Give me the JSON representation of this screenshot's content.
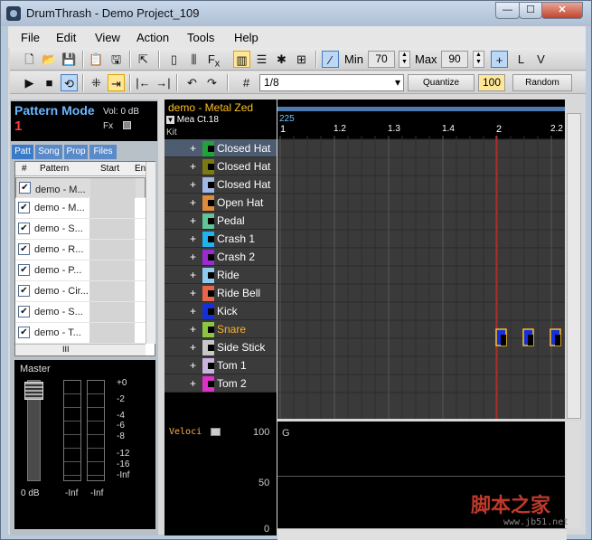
{
  "window": {
    "title": "DrumThrash - Demo Project_109",
    "min": "—",
    "max": "☐",
    "close": "✕"
  },
  "menu": [
    "File",
    "Edit",
    "View",
    "Action",
    "Tools",
    "Help"
  ],
  "toolbar": {
    "min_label": "Min",
    "min_value": "70",
    "max_label": "Max",
    "max_value": "90",
    "grid_value": "1/8",
    "quantize_label": "Quantize",
    "quantize_value": "100",
    "random_label": "Random"
  },
  "pattern_mode": {
    "title": "Pattern Mode",
    "vol": "Vol: 0 dB",
    "number": "1",
    "fx": "Fx"
  },
  "tabs": [
    "Patt",
    "Song",
    "Prop",
    "Files"
  ],
  "pattern_list": {
    "headers": [
      "#",
      "Pattern",
      "Start",
      "En"
    ],
    "rows": [
      "demo - M...",
      "demo - M...",
      "demo - S...",
      "demo - R...",
      "demo - P...",
      "demo - Cir...",
      "demo - S...",
      "demo - T..."
    ],
    "scroll_label": "III"
  },
  "master": {
    "label": "Master",
    "scale": [
      "+0",
      "-2",
      "-4",
      "-6",
      "-8",
      "-12",
      "-16",
      "-Inf"
    ],
    "fader_value": "0 dB",
    "left_meter": "-Inf",
    "right_meter": "-Inf"
  },
  "pattern": {
    "name": "demo - Metal Zed",
    "measure": "Mea Ct.18",
    "kit_label": "Kit"
  },
  "kit": [
    {
      "name": "Closed Hat",
      "color": "#21a339",
      "highlight": false
    },
    {
      "name": "Closed Hat",
      "color": "#7a7a12",
      "highlight": false
    },
    {
      "name": "Closed Hat",
      "color": "#a0b8e8",
      "highlight": false
    },
    {
      "name": "Open Hat",
      "color": "#e08a3c",
      "highlight": false
    },
    {
      "name": "Pedal",
      "color": "#5fc496",
      "highlight": false
    },
    {
      "name": "Crash 1",
      "color": "#1fb3f0",
      "highlight": false
    },
    {
      "name": "Crash 2",
      "color": "#9a2bd0",
      "highlight": false
    },
    {
      "name": "Ride",
      "color": "#90c8ee",
      "highlight": false
    },
    {
      "name": "Ride Bell",
      "color": "#e8644a",
      "highlight": false
    },
    {
      "name": "Kick",
      "color": "#1530d8",
      "highlight": false
    },
    {
      "name": "Snare",
      "color": "#8cc63f",
      "highlight": true
    },
    {
      "name": "Side Stick",
      "color": "#c8c8c8",
      "highlight": false
    },
    {
      "name": "Tom 1",
      "color": "#c8b4de",
      "highlight": false
    },
    {
      "name": "Tom 2",
      "color": "#e030c8",
      "highlight": false
    }
  ],
  "timeline": {
    "position": "225",
    "beats": [
      "1",
      "1.2",
      "1.3",
      "1.4",
      "2",
      "2.2"
    ]
  },
  "velocity": {
    "label": "Veloci",
    "scale": [
      "100",
      "50",
      "0"
    ],
    "lane": "G"
  },
  "watermark": {
    "text": "脚本之家",
    "url": "www.jb51.net"
  }
}
